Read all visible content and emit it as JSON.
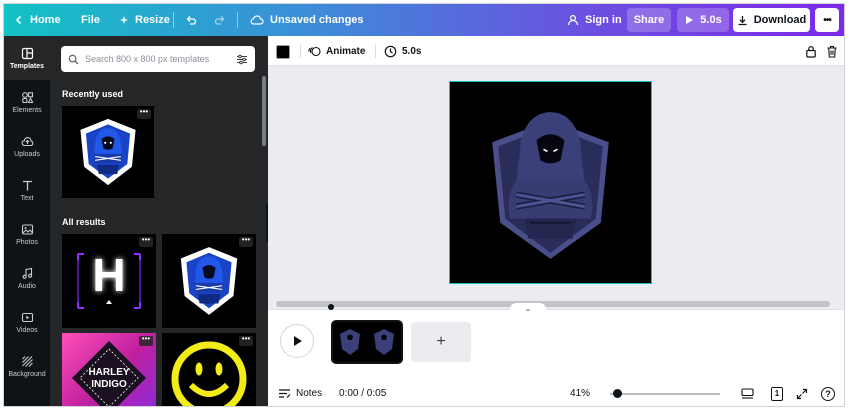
{
  "topbar": {
    "home_label": "Home",
    "file_label": "File",
    "resize_label": "Resize",
    "status_text": "Unsaved changes",
    "signin_label": "Sign in",
    "share_label": "Share",
    "duration_label": "5.0s",
    "download_label": "Download",
    "more_label": "•••"
  },
  "rail": {
    "items": [
      {
        "label": "Templates",
        "icon": "templates-icon"
      },
      {
        "label": "Elements",
        "icon": "elements-icon"
      },
      {
        "label": "Uploads",
        "icon": "uploads-icon"
      },
      {
        "label": "Text",
        "icon": "text-icon"
      },
      {
        "label": "Photos",
        "icon": "photos-icon"
      },
      {
        "label": "Audio",
        "icon": "audio-icon"
      },
      {
        "label": "Videos",
        "icon": "videos-icon"
      },
      {
        "label": "Background",
        "icon": "background-icon"
      }
    ]
  },
  "panel": {
    "search_placeholder": "Search 800 x 800 px templates",
    "recent_title": "Recently used",
    "all_title": "All results",
    "thumb_more": "•••",
    "harley_line1": "HARLEY",
    "harley_line2": "INDIGO",
    "h_letter": "H"
  },
  "editor": {
    "animate_label": "Animate",
    "duration_label": "5.0s",
    "swatch_color": "#000000"
  },
  "timeline": {
    "add_label": "+",
    "handle_label": "⌄"
  },
  "footer": {
    "notes_label": "Notes",
    "time_label": "0:00 / 0:05",
    "zoom_label": "41%",
    "page_number": "1",
    "help_label": "?"
  },
  "colors": {
    "accent_start": "#12c2c5",
    "accent_end": "#7d2ae8",
    "panel_bg": "#252627",
    "rail_bg": "#0e1318",
    "selection": "#12c2c5"
  }
}
